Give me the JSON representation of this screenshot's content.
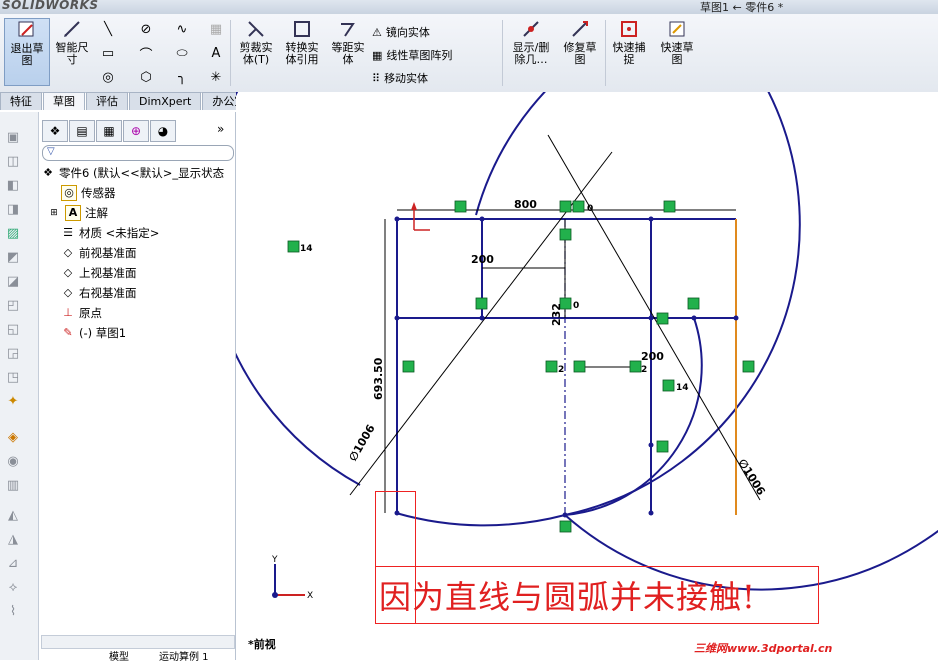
{
  "app": {
    "logo": "SOLIDWORKS",
    "title": "草图1 ← 零件6 *"
  },
  "ribbon": {
    "exit_sketch": "退出草\n图",
    "smart_dim": "智能尺\n寸",
    "trim": "剪裁实\n体(T)",
    "convert": "转换实\n体引用",
    "offset": "等距实\n体",
    "mirror": "镜向实体",
    "linear_pattern": "线性草图阵列",
    "move": "移动实体",
    "display_delete": "显示/删\n除几…",
    "repair": "修复草\n图",
    "quick_snap": "快速捕\n捉",
    "rapid_sketch": "快速草\n图"
  },
  "tabs": [
    {
      "label": "特征",
      "active": false
    },
    {
      "label": "草图",
      "active": true
    },
    {
      "label": "评估",
      "active": false
    },
    {
      "label": "DimXpert",
      "active": false
    },
    {
      "label": "办公室产品",
      "active": false
    }
  ],
  "tree": {
    "root": "零件6  (默认<<默认>_显示状态",
    "items": [
      {
        "label": "传感器",
        "icon": "sensor-icon"
      },
      {
        "label": "注解",
        "icon": "annotation-icon"
      },
      {
        "label": "材质 <未指定>",
        "icon": "material-icon"
      },
      {
        "label": "前视基准面",
        "icon": "plane-icon"
      },
      {
        "label": "上视基准面",
        "icon": "plane-icon"
      },
      {
        "label": "右视基准面",
        "icon": "plane-icon"
      },
      {
        "label": "原点",
        "icon": "origin-icon"
      },
      {
        "label": "(-) 草图1",
        "icon": "sketch-icon"
      }
    ],
    "bottom_tabs": [
      "模型",
      "运动算例 1"
    ]
  },
  "sketch": {
    "dim_800": "800",
    "dim_200_top": "200",
    "dim_232": "232",
    "dim_200_mid": "200",
    "dim_693": "693.50",
    "dia_left": "∅1006",
    "dia_right": "∅1006",
    "rel_14a": "14",
    "rel_14b": "14",
    "rel_0a": "0",
    "rel_0b": "0",
    "rel_2": "2",
    "rel_2b": "2"
  },
  "view_label": "*前视",
  "axis": {
    "x": "X",
    "y": "Y"
  },
  "caption": "因为直线与圆弧并未接触!",
  "watermark": "三维网www.3dportal.cn",
  "colors": {
    "sketch_line": "#1a1a8c",
    "relation_green": "#22b14c",
    "selected": "#e08a1e",
    "note_red": "#e02020"
  }
}
